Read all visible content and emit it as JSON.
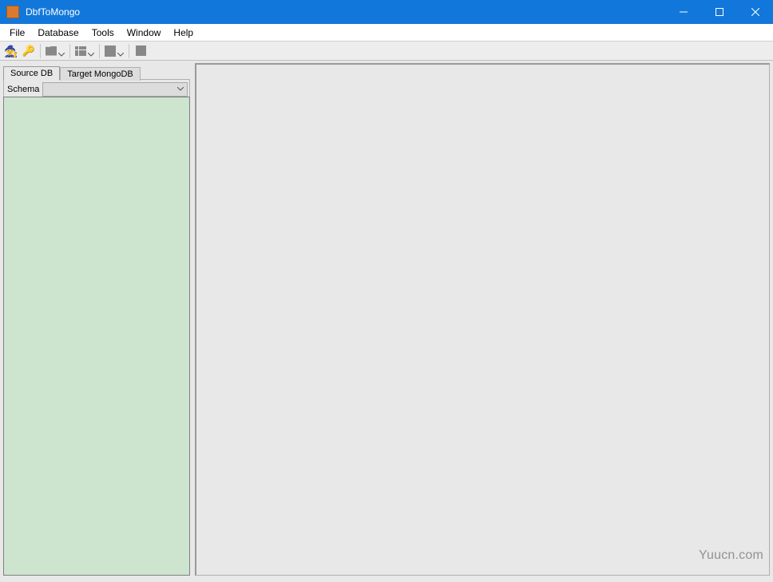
{
  "window": {
    "title": "DbfToMongo"
  },
  "menubar": {
    "file": "File",
    "database": "Database",
    "tools": "Tools",
    "window": "Window",
    "help": "Help"
  },
  "tabs": {
    "source": "Source DB",
    "target": "Target MongoDB"
  },
  "schema": {
    "label": "Schema",
    "value": ""
  },
  "watermark": "Yuucn.com"
}
